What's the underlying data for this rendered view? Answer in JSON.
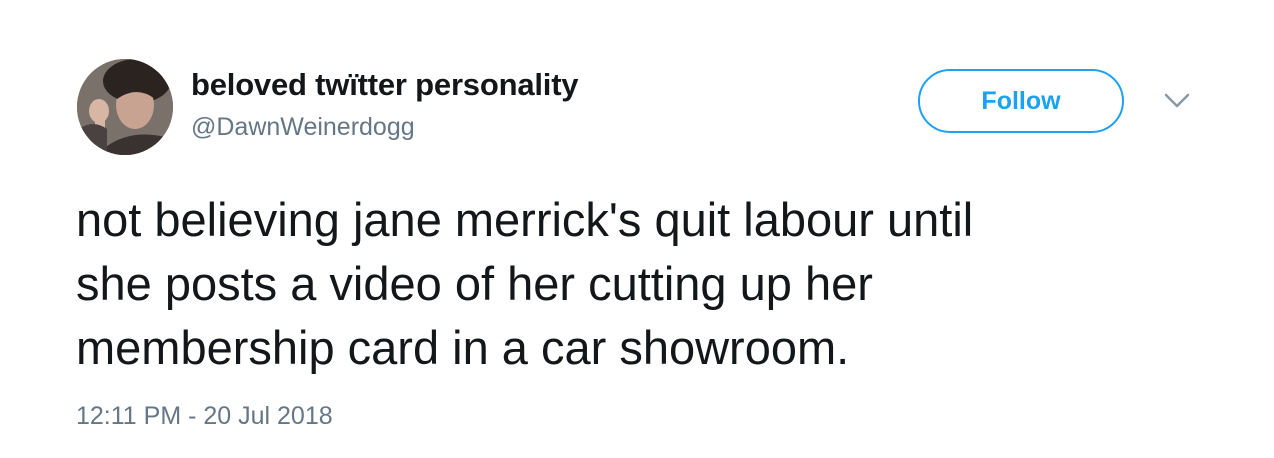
{
  "user": {
    "display_name": "beloved twïtter personality",
    "handle": "@DawnWeinerdogg"
  },
  "follow_button": {
    "label": "Follow"
  },
  "tweet": {
    "text": "not believing jane merrick's quit labour until\nshe posts a video of her cutting up her\nmembership card in a car showroom.",
    "timestamp": "12:11 PM - 20 Jul 2018"
  },
  "icons": {
    "menu": "chevron-down-icon"
  },
  "colors": {
    "accent": "#1da1f2",
    "text_primary": "#14171a",
    "text_secondary": "#657786",
    "background": "#ffffff"
  }
}
